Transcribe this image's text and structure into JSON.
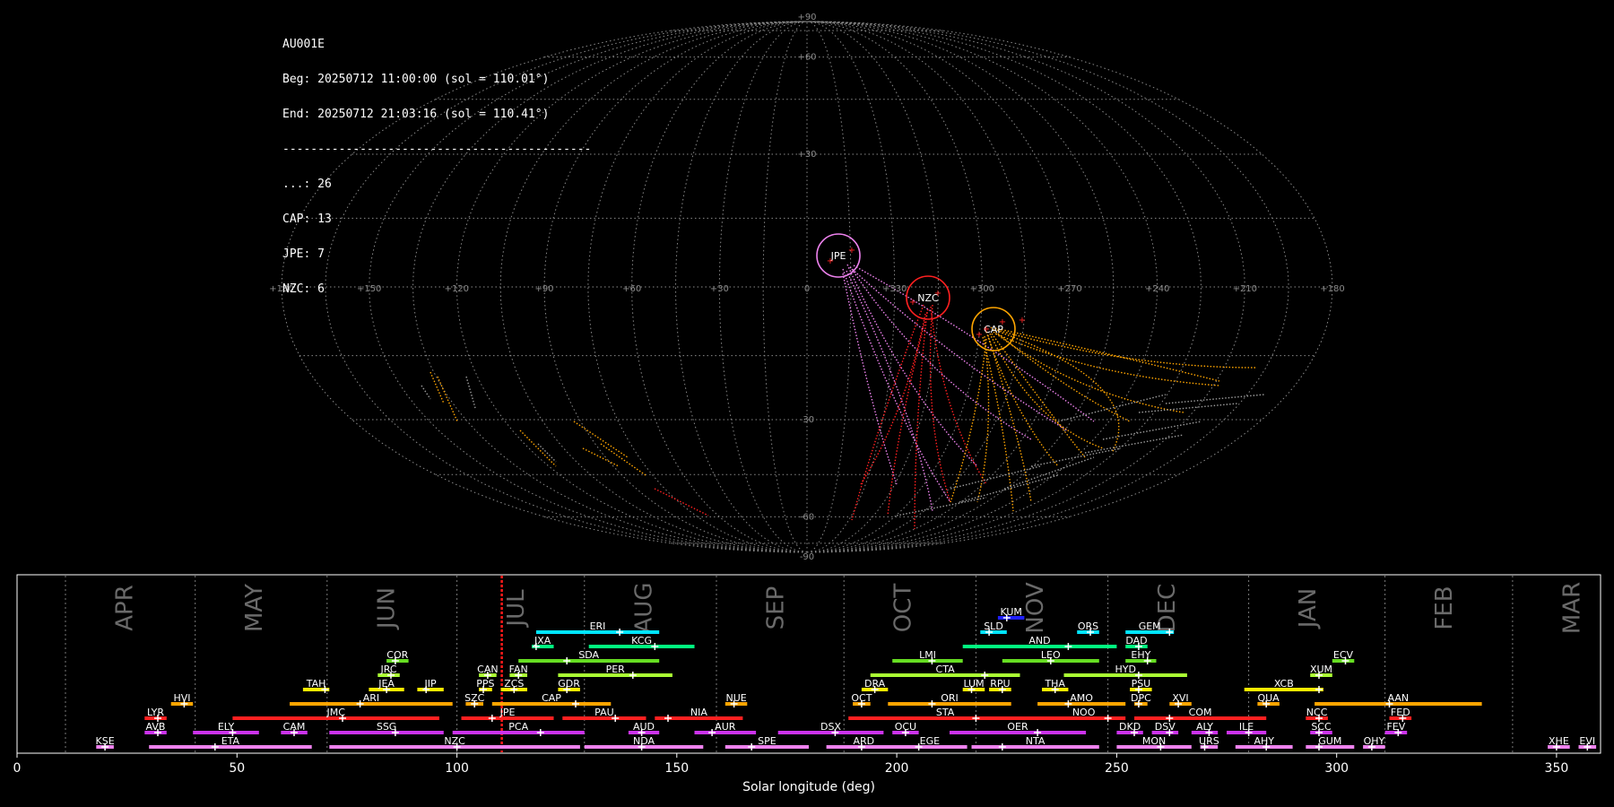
{
  "info": {
    "station": "AU001E",
    "beg": "Beg: 20250712 11:00:00 (sol = 110.01°)",
    "end": "End: 20250712 21:03:16 (sol = 110.41°)",
    "separator": "--------------------------------------------",
    "counts": [
      "...: 26",
      "CAP: 13",
      "JPE: 7",
      "NZC: 6"
    ]
  },
  "sky": {
    "lon_ticks": [
      "+180",
      "+150",
      "+120",
      "+90",
      "+60",
      "+30",
      "0",
      "+330",
      "+300",
      "+270",
      "+240",
      "+210",
      "+180"
    ],
    "lat_ticks": [
      "+90",
      "+60",
      "+30",
      "-30",
      "-60",
      "-90"
    ],
    "radiants": [
      {
        "name": "JPE",
        "color": "#ee82ee"
      },
      {
        "name": "NZC",
        "color": "#ff2020"
      },
      {
        "name": "CAP",
        "color": "#ffa500"
      }
    ]
  },
  "chart_data": {
    "type": "timeline",
    "xlabel": "Solar longitude (deg)",
    "xlim": [
      0,
      360
    ],
    "xticks": [
      0,
      50,
      100,
      150,
      200,
      250,
      300,
      350
    ],
    "current_sol": 110.2,
    "months": [
      {
        "name": "APR",
        "start": 11
      },
      {
        "name": "MAY",
        "start": 40.5
      },
      {
        "name": "JUN",
        "start": 70.5
      },
      {
        "name": "JUL",
        "start": 100
      },
      {
        "name": "AUG",
        "start": 129
      },
      {
        "name": "SEP",
        "start": 159
      },
      {
        "name": "OCT",
        "start": 188
      },
      {
        "name": "NOV",
        "start": 218
      },
      {
        "name": "DEC",
        "start": 248
      },
      {
        "name": "JAN",
        "start": 280
      },
      {
        "name": "FEB",
        "start": 311
      },
      {
        "name": "MAR",
        "start": 340
      }
    ],
    "showers": [
      {
        "name": "KUM",
        "start": 223,
        "end": 229,
        "peak": 225,
        "row": 9,
        "color": "#2020ff"
      },
      {
        "name": "ERI",
        "start": 118,
        "end": 146,
        "peak": 137,
        "row": 8,
        "color": "#00e5ff"
      },
      {
        "name": "SLD",
        "start": 219,
        "end": 225,
        "peak": 221,
        "row": 8,
        "color": "#00e5ff"
      },
      {
        "name": "ORS",
        "start": 241,
        "end": 246,
        "peak": 244,
        "row": 8,
        "color": "#00e5ff"
      },
      {
        "name": "GEM",
        "start": 252,
        "end": 263,
        "peak": 262,
        "row": 8,
        "color": "#00e5ff"
      },
      {
        "name": "JXA",
        "start": 117,
        "end": 122,
        "peak": 118,
        "row": 7,
        "color": "#00ff80"
      },
      {
        "name": "KCG",
        "start": 130,
        "end": 154,
        "peak": 145,
        "row": 7,
        "color": "#00ff80"
      },
      {
        "name": "AND",
        "start": 215,
        "end": 250,
        "peak": 239,
        "row": 7,
        "color": "#00ff80"
      },
      {
        "name": "DAD",
        "start": 252,
        "end": 257,
        "peak": 255,
        "row": 7,
        "color": "#00ff80"
      },
      {
        "name": "COR",
        "start": 84,
        "end": 89,
        "peak": 86,
        "row": 6,
        "color": "#66dd22"
      },
      {
        "name": "SDA",
        "start": 114,
        "end": 146,
        "peak": 125,
        "row": 6,
        "color": "#66dd22"
      },
      {
        "name": "LMI",
        "start": 199,
        "end": 215,
        "peak": 208,
        "row": 6,
        "color": "#66dd22"
      },
      {
        "name": "LEO",
        "start": 224,
        "end": 246,
        "peak": 235,
        "row": 6,
        "color": "#66dd22"
      },
      {
        "name": "EHY",
        "start": 252,
        "end": 259,
        "peak": 257,
        "row": 6,
        "color": "#66dd22"
      },
      {
        "name": "ECV",
        "start": 299,
        "end": 304,
        "peak": 302,
        "row": 6,
        "color": "#66dd22"
      },
      {
        "name": "JRC",
        "start": 82,
        "end": 87,
        "peak": 85,
        "row": 5,
        "color": "#aaff33"
      },
      {
        "name": "CAN",
        "start": 105,
        "end": 109,
        "peak": 107,
        "row": 5,
        "color": "#aaff33"
      },
      {
        "name": "FAN",
        "start": 112,
        "end": 116,
        "peak": 114,
        "row": 5,
        "color": "#aaff33"
      },
      {
        "name": "PER",
        "start": 123,
        "end": 149,
        "peak": 140,
        "row": 5,
        "color": "#aaff33"
      },
      {
        "name": "CTA",
        "start": 194,
        "end": 228,
        "peak": 220,
        "row": 5,
        "color": "#aaff33"
      },
      {
        "name": "HYD",
        "start": 238,
        "end": 266,
        "peak": 255,
        "row": 5,
        "color": "#aaff33"
      },
      {
        "name": "XUM",
        "start": 294,
        "end": 299,
        "peak": 296,
        "row": 5,
        "color": "#aaff33"
      },
      {
        "name": "TAH",
        "start": 65,
        "end": 71,
        "peak": 70,
        "row": 4,
        "color": "#ffee00"
      },
      {
        "name": "JEA",
        "start": 80,
        "end": 88,
        "peak": 84,
        "row": 4,
        "color": "#ffee00"
      },
      {
        "name": "JIP",
        "start": 91,
        "end": 97,
        "peak": 93,
        "row": 4,
        "color": "#ffee00"
      },
      {
        "name": "PPS",
        "start": 105,
        "end": 108,
        "peak": 106,
        "row": 4,
        "color": "#ffee00"
      },
      {
        "name": "ZCS",
        "start": 110,
        "end": 116,
        "peak": 113,
        "row": 4,
        "color": "#ffee00"
      },
      {
        "name": "GDR",
        "start": 123,
        "end": 128,
        "peak": 125,
        "row": 4,
        "color": "#ffee00"
      },
      {
        "name": "DRA",
        "start": 192,
        "end": 198,
        "peak": 195,
        "row": 4,
        "color": "#ffee00"
      },
      {
        "name": "LUM",
        "start": 215,
        "end": 220,
        "peak": 217,
        "row": 4,
        "color": "#ffee00"
      },
      {
        "name": "RPU",
        "start": 221,
        "end": 226,
        "peak": 224,
        "row": 4,
        "color": "#ffee00"
      },
      {
        "name": "THA",
        "start": 233,
        "end": 239,
        "peak": 236,
        "row": 4,
        "color": "#ffee00"
      },
      {
        "name": "PSU",
        "start": 253,
        "end": 258,
        "peak": 255,
        "row": 4,
        "color": "#ffee00"
      },
      {
        "name": "XCB",
        "start": 279,
        "end": 297,
        "peak": 296,
        "row": 4,
        "color": "#ffee00"
      },
      {
        "name": "HVI",
        "start": 35,
        "end": 40,
        "peak": 38,
        "row": 3,
        "color": "#ffa500"
      },
      {
        "name": "ARI",
        "start": 62,
        "end": 99,
        "peak": 78,
        "row": 3,
        "color": "#ffa500"
      },
      {
        "name": "SZC",
        "start": 102,
        "end": 106,
        "peak": 104,
        "row": 3,
        "color": "#ffa500"
      },
      {
        "name": "CAP",
        "start": 108,
        "end": 135,
        "peak": 127,
        "row": 3,
        "color": "#ffa500"
      },
      {
        "name": "NUE",
        "start": 161,
        "end": 166,
        "peak": 163,
        "row": 3,
        "color": "#ffa500"
      },
      {
        "name": "OCT",
        "start": 190,
        "end": 194,
        "peak": 192,
        "row": 3,
        "color": "#ffa500"
      },
      {
        "name": "ORI",
        "start": 198,
        "end": 226,
        "peak": 208,
        "row": 3,
        "color": "#ffa500"
      },
      {
        "name": "AMO",
        "start": 232,
        "end": 252,
        "peak": 239,
        "row": 3,
        "color": "#ffa500"
      },
      {
        "name": "DPC",
        "start": 254,
        "end": 257,
        "peak": 255,
        "row": 3,
        "color": "#ffa500"
      },
      {
        "name": "XVI",
        "start": 262,
        "end": 267,
        "peak": 264,
        "row": 3,
        "color": "#ffa500"
      },
      {
        "name": "QUA",
        "start": 282,
        "end": 287,
        "peak": 284,
        "row": 3,
        "color": "#ffa500"
      },
      {
        "name": "AAN",
        "start": 295,
        "end": 333,
        "peak": 312,
        "row": 3,
        "color": "#ffa500"
      },
      {
        "name": "LYR",
        "start": 29,
        "end": 34,
        "peak": 32,
        "row": 2,
        "color": "#ff2020"
      },
      {
        "name": "JMC",
        "start": 49,
        "end": 96,
        "peak": 74,
        "row": 2,
        "color": "#ff2020"
      },
      {
        "name": "JPE",
        "start": 101,
        "end": 122,
        "peak": 108,
        "row": 2,
        "color": "#ff2020"
      },
      {
        "name": "PAU",
        "start": 124,
        "end": 143,
        "peak": 136,
        "row": 2,
        "color": "#ff2020"
      },
      {
        "name": "NIA",
        "start": 145,
        "end": 165,
        "peak": 148,
        "row": 2,
        "color": "#ff2020"
      },
      {
        "name": "STA",
        "start": 189,
        "end": 233,
        "peak": 218,
        "row": 2,
        "color": "#ff2020"
      },
      {
        "name": "NOO",
        "start": 233,
        "end": 252,
        "peak": 248,
        "row": 2,
        "color": "#ff2020"
      },
      {
        "name": "COM",
        "start": 254,
        "end": 284,
        "peak": 262,
        "row": 2,
        "color": "#ff2020"
      },
      {
        "name": "NCC",
        "start": 293,
        "end": 298,
        "peak": 296,
        "row": 2,
        "color": "#ff2020"
      },
      {
        "name": "FED",
        "start": 312,
        "end": 317,
        "peak": 315,
        "row": 2,
        "color": "#ff2020"
      },
      {
        "name": "AVB",
        "start": 29,
        "end": 34,
        "peak": 32,
        "row": 1,
        "color": "#cc33ee"
      },
      {
        "name": "ELY",
        "start": 40,
        "end": 55,
        "peak": 49,
        "row": 1,
        "color": "#cc33ee"
      },
      {
        "name": "CAM",
        "start": 60,
        "end": 66,
        "peak": 63,
        "row": 1,
        "color": "#cc33ee"
      },
      {
        "name": "SSG",
        "start": 71,
        "end": 97,
        "peak": 86,
        "row": 1,
        "color": "#cc33ee"
      },
      {
        "name": "PCA",
        "start": 99,
        "end": 129,
        "peak": 119,
        "row": 1,
        "color": "#cc33ee"
      },
      {
        "name": "AUD",
        "start": 139,
        "end": 146,
        "peak": 142,
        "row": 1,
        "color": "#cc33ee"
      },
      {
        "name": "AUR",
        "start": 154,
        "end": 168,
        "peak": 158,
        "row": 1,
        "color": "#cc33ee"
      },
      {
        "name": "DSX",
        "start": 173,
        "end": 197,
        "peak": 186,
        "row": 1,
        "color": "#cc33ee"
      },
      {
        "name": "OCU",
        "start": 199,
        "end": 205,
        "peak": 202,
        "row": 1,
        "color": "#cc33ee"
      },
      {
        "name": "OER",
        "start": 212,
        "end": 243,
        "peak": 232,
        "row": 1,
        "color": "#cc33ee"
      },
      {
        "name": "DKD",
        "start": 250,
        "end": 256,
        "peak": 254,
        "row": 1,
        "color": "#cc33ee"
      },
      {
        "name": "DSV",
        "start": 258,
        "end": 264,
        "peak": 262,
        "row": 1,
        "color": "#cc33ee"
      },
      {
        "name": "ALY",
        "start": 267,
        "end": 273,
        "peak": 271,
        "row": 1,
        "color": "#cc33ee"
      },
      {
        "name": "ILE",
        "start": 275,
        "end": 284,
        "peak": 280,
        "row": 1,
        "color": "#cc33ee"
      },
      {
        "name": "SCC",
        "start": 294,
        "end": 299,
        "peak": 296,
        "row": 1,
        "color": "#cc33ee"
      },
      {
        "name": "FEV",
        "start": 311,
        "end": 316,
        "peak": 314,
        "row": 1,
        "color": "#cc33ee"
      },
      {
        "name": "KSE",
        "start": 18,
        "end": 22,
        "peak": 20,
        "row": 0,
        "color": "#ee82ee"
      },
      {
        "name": "ETA",
        "start": 30,
        "end": 67,
        "peak": 45,
        "row": 0,
        "color": "#ee82ee"
      },
      {
        "name": "NZC",
        "start": 71,
        "end": 128,
        "peak": 100,
        "row": 0,
        "color": "#ee82ee"
      },
      {
        "name": "NDA",
        "start": 129,
        "end": 156,
        "peak": 142,
        "row": 0,
        "color": "#ee82ee"
      },
      {
        "name": "SPE",
        "start": 161,
        "end": 180,
        "peak": 167,
        "row": 0,
        "color": "#ee82ee"
      },
      {
        "name": "ARD",
        "start": 184,
        "end": 201,
        "peak": 192,
        "row": 0,
        "color": "#ee82ee"
      },
      {
        "name": "EGE",
        "start": 199,
        "end": 216,
        "peak": 205,
        "row": 0,
        "color": "#ee82ee"
      },
      {
        "name": "NTA",
        "start": 217,
        "end": 246,
        "peak": 224,
        "row": 0,
        "color": "#ee82ee"
      },
      {
        "name": "MON",
        "start": 250,
        "end": 267,
        "peak": 260,
        "row": 0,
        "color": "#ee82ee"
      },
      {
        "name": "URS",
        "start": 269,
        "end": 273,
        "peak": 270,
        "row": 0,
        "color": "#ee82ee"
      },
      {
        "name": "AHY",
        "start": 277,
        "end": 290,
        "peak": 284,
        "row": 0,
        "color": "#ee82ee"
      },
      {
        "name": "GUM",
        "start": 293,
        "end": 304,
        "peak": 296,
        "row": 0,
        "color": "#ee82ee"
      },
      {
        "name": "OHY",
        "start": 306,
        "end": 311,
        "peak": 308,
        "row": 0,
        "color": "#ee82ee"
      },
      {
        "name": "XHE",
        "start": 348,
        "end": 353,
        "peak": 350,
        "row": 0,
        "color": "#ee82ee"
      },
      {
        "name": "EVI",
        "start": 355,
        "end": 359,
        "peak": 357,
        "row": 0,
        "color": "#ee82ee"
      }
    ]
  }
}
